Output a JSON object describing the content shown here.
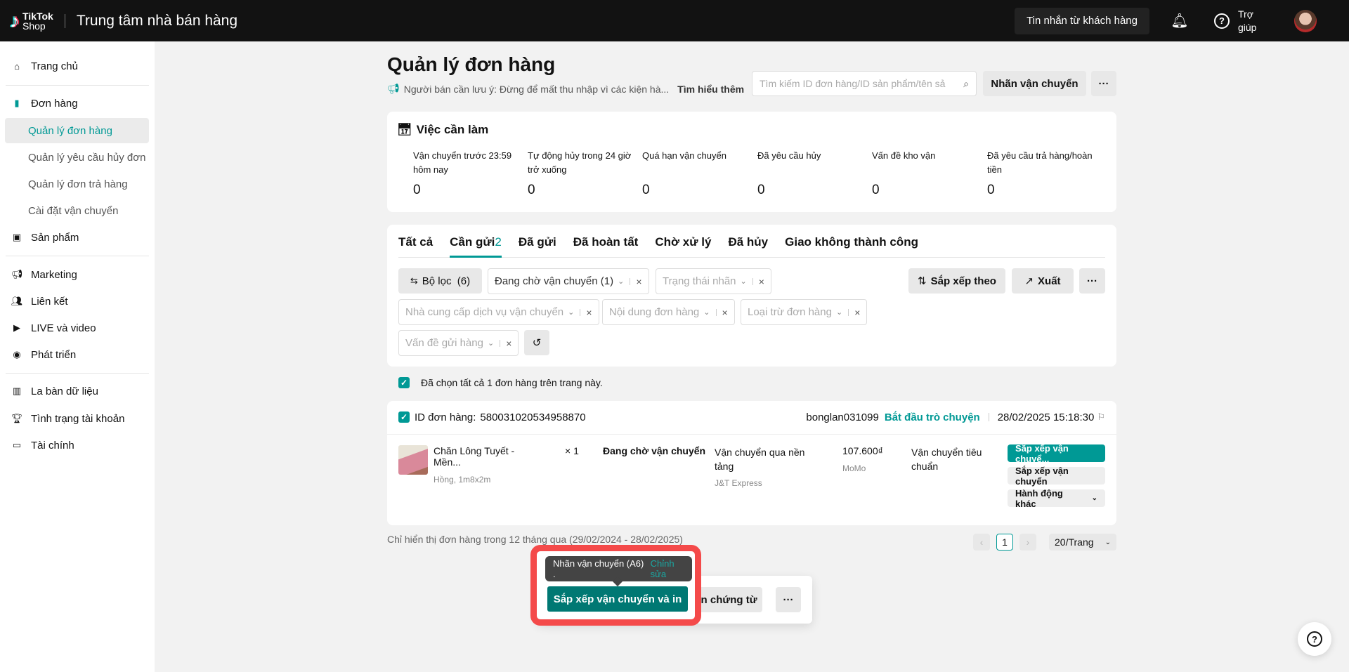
{
  "header": {
    "logo_top": "TikTok",
    "logo_bottom": "Shop",
    "title": "Trung tâm nhà bán hàng",
    "messages_button": "Tin nhắn từ khách hàng",
    "help_label": "Trợ giúp"
  },
  "sidebar": {
    "items": [
      {
        "label": "Trang chủ"
      },
      {
        "label": "Đơn hàng"
      },
      {
        "label": "Quản lý đơn hàng"
      },
      {
        "label": "Quản lý yêu cầu hủy đơn"
      },
      {
        "label": "Quản lý đơn trả hàng"
      },
      {
        "label": "Cài đặt vận chuyển"
      },
      {
        "label": "Sản phẩm"
      },
      {
        "label": "Marketing"
      },
      {
        "label": "Liên kết"
      },
      {
        "label": "LIVE và video"
      },
      {
        "label": "Phát triển"
      },
      {
        "label": "La bàn dữ liệu"
      },
      {
        "label": "Tình trạng tài khoản"
      },
      {
        "label": "Tài chính"
      }
    ]
  },
  "page": {
    "title": "Quản lý đơn hàng",
    "notice": "Người bán cần lưu ý: Đừng để mất thu nhập vì các kiện hà...",
    "learn_more": "Tìm hiểu thêm",
    "search_placeholder": "Tìm kiếm ID đơn hàng/ID sản phẩm/tên sả",
    "shipping_label_button": "Nhãn vận chuyển",
    "more": "···"
  },
  "todo": {
    "title": "Việc cần làm",
    "stats": [
      {
        "label": "Vận chuyển trước 23:59 hôm nay",
        "value": "0"
      },
      {
        "label": "Tự động hủy trong 24 giờ trở xuống",
        "value": "0"
      },
      {
        "label": "Quá hạn vận chuyển",
        "value": "0"
      },
      {
        "label": "Đã yêu cầu hủy",
        "value": "0"
      },
      {
        "label": "Vấn đề kho vận",
        "value": "0"
      },
      {
        "label": "Đã yêu cầu trả hàng/hoàn tiền",
        "value": "0"
      }
    ]
  },
  "tabs": [
    {
      "label": "Tất cả"
    },
    {
      "label": "Cần gửi",
      "count": "2"
    },
    {
      "label": "Đã gửi"
    },
    {
      "label": "Đã hoàn tất"
    },
    {
      "label": "Chờ xử lý"
    },
    {
      "label": "Đã hủy"
    },
    {
      "label": "Giao không thành công"
    }
  ],
  "filters": {
    "filter_button": "Bộ lọc",
    "filter_count": "(6)",
    "chips": [
      "Đang chờ vận chuyển (1)",
      "Trạng thái nhãn",
      "Nhà cung cấp dịch vụ vận chuyển",
      "Nội dung đơn hàng",
      "Loại trừ đơn hàng",
      "Vấn đề gửi hàng"
    ],
    "sort": "Sắp xếp theo",
    "export": "Xuất",
    "more": "···"
  },
  "select_all": "Đã chọn tất cả 1 đơn hàng trên trang này.",
  "order": {
    "id_label": "ID đơn hàng:",
    "id": "580031020534958870",
    "buyer": "bonglan031099",
    "chat": "Bắt đầu trò chuyện",
    "date": "28/02/2025 15:18:30",
    "product_name": "Chăn Lông Tuyết - Mền...",
    "variant": "Hồng, 1m8x2m",
    "qty": "× 1",
    "status": "Đang chờ vận chuyển",
    "shipping_type": "Vận chuyển qua nền tảng",
    "carrier": "J&T Express",
    "price": "107.600₫",
    "payment": "MoMo",
    "delivery": "Vận chuyển tiêu chuẩn",
    "action_primary": "Sắp xếp vận chuyể...",
    "action_secondary": "Sắp xếp vận chuyển",
    "action_more": "Hành động khác"
  },
  "footer": {
    "range_note": "Chỉ hiển thị đơn hàng trong 12 tháng qua (29/02/2024 - 28/02/2025)",
    "page": "1",
    "per_page": "20/Trang"
  },
  "bulk": {
    "tooltip": "Nhãn vận chuyển (A6) .",
    "tooltip_edit": "Chỉnh sửa",
    "arrange_print": "Sắp xếp vận chuyển và in",
    "print_docs": "In chứng từ",
    "more": "···"
  },
  "colors": {
    "accent": "#009995",
    "highlight": "#f44a4a"
  }
}
